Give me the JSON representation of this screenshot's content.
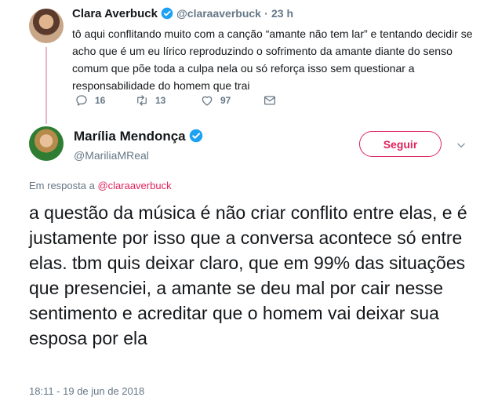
{
  "parent_tweet": {
    "name": "Clara Averbuck",
    "handle": "@claraaverbuck",
    "separator": "·",
    "age": "23 h",
    "text": "tô aqui conflitando muito com a canção “amante não tem lar” e tentando decidir se acho que é um eu lírico reproduzindo o sofrimento da amante diante do senso comum que põe toda a culpa nela ou só reforça isso sem questionar a responsabilidade do homem que trai",
    "actions": {
      "reply_count": "16",
      "retweet_count": "13",
      "like_count": "97"
    },
    "icons": [
      "verified-icon",
      "reply-icon",
      "retweet-icon",
      "like-icon",
      "message-icon"
    ]
  },
  "main_tweet": {
    "name": "Marília Mendonça",
    "handle": "@MariliaMReal",
    "follow_label": "Seguir",
    "reply_prefix": "Em resposta a",
    "reply_handle": "@claraaverbuck",
    "text": "a questão da música é não criar conflito entre elas, e é justamente por isso que a conversa acontece só entre elas. tbm quis deixar claro, que em 99% das situações que presenciei, a amante se deu mal por cair nesse sentimento e acreditar que o homem vai deixar sua esposa por ela",
    "timestamp": "18:11 - 19 de jun de 2018",
    "icons": [
      "verified-icon",
      "chevron-down-icon"
    ]
  },
  "colors": {
    "accent": "#e0245e",
    "verified": "#1da1f2",
    "muted_text": "#657786",
    "thread_line": "#e6b7c6"
  }
}
